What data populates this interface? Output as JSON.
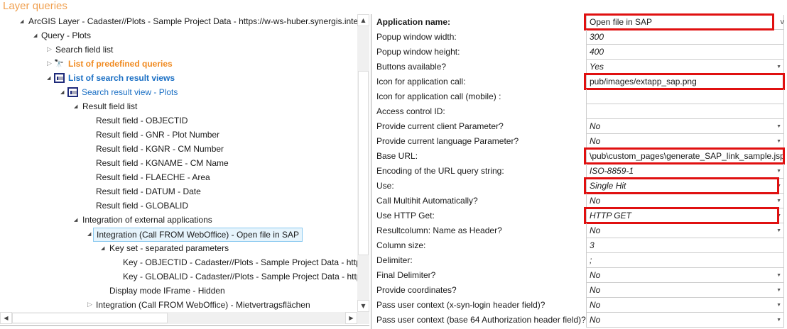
{
  "title": "Layer queries",
  "tree": [
    {
      "label": "ArcGIS Layer - Cadaster//Plots - Sample Project Data - https://w-ws-huber.synergis.intern/m",
      "state": "open"
    },
    {
      "label": "Query - Plots",
      "state": "open"
    },
    {
      "label": "Search field list",
      "state": "closed"
    },
    {
      "label": "List of predefined queries",
      "state": "closed",
      "icon": "binoculars-icon"
    },
    {
      "label": "List of search result views",
      "state": "open",
      "icon": "table-icon"
    },
    {
      "label": "Search result view - Plots",
      "state": "open",
      "icon": "table-icon"
    },
    {
      "label": "Result field list",
      "state": "open"
    },
    {
      "label": "Result field - OBJECTID"
    },
    {
      "label": "Result field - GNR - Plot Number"
    },
    {
      "label": "Result field - KGNR - CM Number"
    },
    {
      "label": "Result field - KGNAME - CM Name"
    },
    {
      "label": "Result field - FLAECHE - Area"
    },
    {
      "label": "Result field - DATUM - Date"
    },
    {
      "label": "Result field - GLOBALID"
    },
    {
      "label": "Integration of external applications",
      "state": "open"
    },
    {
      "label": "Integration (Call FROM WebOffice) - Open file in SAP",
      "state": "open",
      "selected": true
    },
    {
      "label": "Key set - separated parameters",
      "state": "open"
    },
    {
      "label": "Key - OBJECTID - Cadaster//Plots - Sample Project Data - https://"
    },
    {
      "label": "Key - GLOBALID - Cadaster//Plots - Sample Project Data - https://"
    },
    {
      "label": "Display mode IFrame - Hidden"
    },
    {
      "label": "Integration (Call FROM WebOffice) - Mietvertragsflächen",
      "state": "closed"
    }
  ],
  "properties": [
    {
      "label": "Application name:",
      "value": "Open file in SAP",
      "bold": true,
      "highlight": true,
      "dropdown": "v"
    },
    {
      "label": "Popup window width:",
      "value": "300"
    },
    {
      "label": "Popup window height:",
      "value": "400"
    },
    {
      "label": "Buttons available?",
      "value": "Yes",
      "dropdown": "▼"
    },
    {
      "label": "Icon for application call:",
      "value": "pub/images/extapp_sap.png",
      "highlight": true
    },
    {
      "label": "Icon for application call (mobile) :",
      "value": ""
    },
    {
      "label": "Access control ID:",
      "value": ""
    },
    {
      "label": "Provide current client Parameter?",
      "value": "No",
      "dropdown": "▼"
    },
    {
      "label": "Provide current language Parameter?",
      "value": "No",
      "dropdown": "▼"
    },
    {
      "label": "Base URL:",
      "value": "\\pub\\custom_pages\\generate_SAP_link_sample.jsp",
      "highlight": true
    },
    {
      "label": "Encoding of the URL query string:",
      "value": "ISO-8859-1",
      "dropdown": "▼"
    },
    {
      "label": "Use:",
      "value": "Single Hit",
      "highlight": true,
      "dropdown": "▼"
    },
    {
      "label": "Call Multihit Automatically?",
      "value": "No",
      "dropdown": "▼"
    },
    {
      "label": "Use HTTP Get:",
      "value": "HTTP GET",
      "highlight": true,
      "dropdown": "▼"
    },
    {
      "label": "Resultcolumn: Name as Header?",
      "value": "No",
      "dropdown": "▼"
    },
    {
      "label": "Column size:",
      "value": "3"
    },
    {
      "label": "Delimiter:",
      "value": ";"
    },
    {
      "label": "Final Delimiter?",
      "value": "No",
      "dropdown": "▼"
    },
    {
      "label": "Provide coordinates?",
      "value": "No",
      "dropdown": "▼"
    },
    {
      "label": "Pass user context (x-syn-login header field)?",
      "value": "No",
      "dropdown": "▼"
    },
    {
      "label": "Pass user context (base 64 Authorization header field)?",
      "value": "No",
      "dropdown": "▼"
    }
  ],
  "colors": {
    "title": "#f0a050",
    "highlight": "#e01010",
    "orange_node": "#f08a20",
    "blue_node": "#1a6fc4"
  }
}
